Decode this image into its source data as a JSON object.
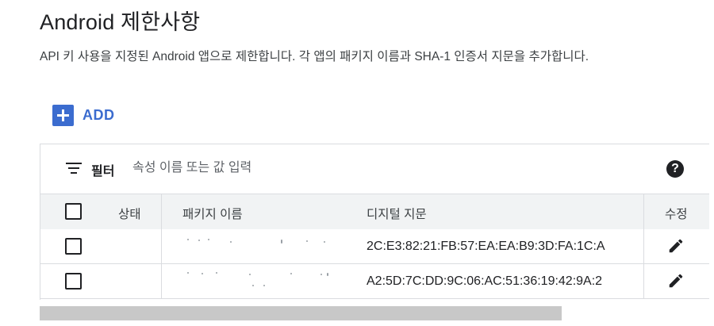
{
  "header": {
    "title": "Android 제한사항",
    "description": "API 키 사용을 지정된 Android 앱으로 제한합니다. 각 앱의 패키지 이름과 SHA-1 인증서 지문을 추가합니다."
  },
  "toolbar": {
    "add_label": "ADD"
  },
  "filter": {
    "label": "필터",
    "placeholder": "속성 이름 또는 값 입력",
    "help_glyph": "?"
  },
  "table": {
    "columns": {
      "status": "상태",
      "package": "패키지 이름",
      "fingerprint": "디지털 지문",
      "edit": "수정"
    },
    "rows": [
      {
        "package": "",
        "fingerprint": "2C:E3:82:21:FB:57:EA:EA:B9:3D:FA:1C:A"
      },
      {
        "package": "",
        "fingerprint": "A2:5D:7C:DD:9C:06:AC:51:36:19:42:9A:2"
      }
    ]
  },
  "icons": {
    "add": "plus-icon",
    "filter": "filter-list-icon",
    "help": "help-circle-icon",
    "edit": "pencil-icon",
    "checkbox": "checkbox-unchecked-icon"
  },
  "colors": {
    "accent": "#3b6ccf",
    "header_bg": "#f1f3f4",
    "border": "#dadce0"
  }
}
